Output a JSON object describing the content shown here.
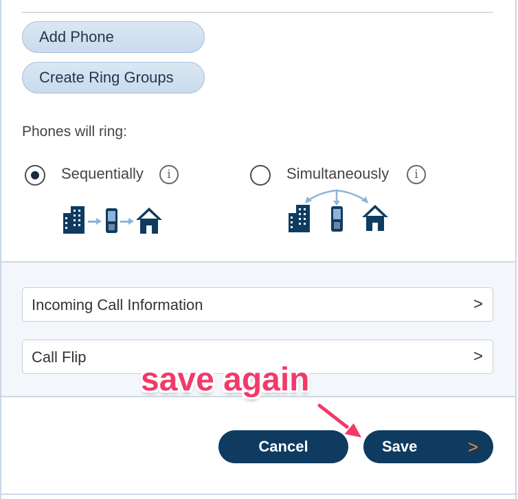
{
  "buttons": {
    "add_phone": "Add Phone",
    "create_ring_groups": "Create Ring Groups"
  },
  "ring": {
    "label": "Phones will ring:",
    "options": [
      {
        "label": "Sequentially",
        "selected": true
      },
      {
        "label": "Simultaneously",
        "selected": false
      }
    ],
    "info_glyph": "i"
  },
  "rows": [
    {
      "label": "Incoming Call Information",
      "chevron": ">"
    },
    {
      "label": "Call Flip",
      "chevron": ">"
    }
  ],
  "annotation": "save again",
  "actions": {
    "cancel": "Cancel",
    "save": "Save",
    "save_chevron": ">"
  },
  "colors": {
    "primary": "#0f3b61",
    "annotation": "#f13a6a",
    "accent_chevron": "#f08a2c",
    "pill_bg": "#d3e2f1"
  }
}
